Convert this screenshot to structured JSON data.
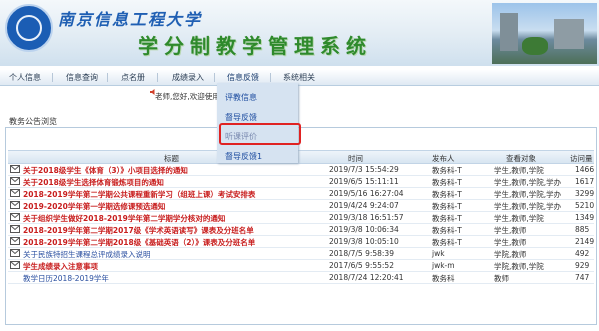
{
  "header": {
    "school_name": "南京信息工程大学",
    "system_name": "学分制教学管理系统"
  },
  "nav": {
    "items": [
      {
        "label": "个人信息"
      },
      {
        "label": "信息查询"
      },
      {
        "label": "点名册"
      },
      {
        "label": "成绩录入"
      },
      {
        "label": "信息反馈"
      },
      {
        "label": "系统相关"
      }
    ]
  },
  "welcome_text": "老师,您好,欢迎使用学分制教学管理系统",
  "dropdown": {
    "items": [
      {
        "label": "评教信息"
      },
      {
        "label": "督导反馈"
      },
      {
        "label": "听课评价"
      },
      {
        "label": "督导反馈1"
      }
    ],
    "highlighted_index": 2
  },
  "notice": {
    "section_title": "教务公告浏览",
    "columns": [
      "标题",
      "时间",
      "发布人",
      "查看对象",
      "访问量"
    ],
    "rows": [
      {
        "title": "关于2018级学生《体育（3）》小项目选择的通知",
        "time": "2019/7/3 15:54:29",
        "publisher": "教务科-T",
        "audience": "学生,教师,学院",
        "views": "1466",
        "style": "red"
      },
      {
        "title": "关于2018级学生选择体育锻炼项目的通知",
        "time": "2019/6/5 15:11:11",
        "publisher": "教务科-T",
        "audience": "学生,教师,学院,学办",
        "views": "1617",
        "style": "red"
      },
      {
        "title": "2018-2019学年第二学期公共课程重新学习（组班上课）考试安排表",
        "time": "2019/5/16 16:27:04",
        "publisher": "教务科-T",
        "audience": "学生,教师,学院,学办",
        "views": "3299",
        "style": "red"
      },
      {
        "title": "2019-2020学年第一学期选修课预选通知",
        "time": "2019/4/24 9:24:07",
        "publisher": "教务科-T",
        "audience": "学生,教师,学院,学办",
        "views": "5210",
        "style": "red"
      },
      {
        "title": "关于组织学生做好2018-2019学年第二学期学分核对的通知",
        "time": "2019/3/18 16:51:57",
        "publisher": "教务科-T",
        "audience": "学生,教师,学院",
        "views": "1349",
        "style": "red"
      },
      {
        "title": "2018-2019学年第二学期2017级《学术英语读写》课表及分班名单",
        "time": "2019/3/8 10:06:34",
        "publisher": "教务科-T",
        "audience": "学生,教师",
        "views": "885",
        "style": "red"
      },
      {
        "title": "2018-2019学年第二学期2018级《基础英语（2）》课表及分班名单",
        "time": "2019/3/8 10:05:10",
        "publisher": "教务科-T",
        "audience": "学生,教师",
        "views": "2149",
        "style": "red"
      },
      {
        "title": "关于民族特招生课程总评成绩录入说明",
        "time": "2018/7/5 9:58:39",
        "publisher": "jwk",
        "audience": "学院,教师",
        "views": "492",
        "style": "blue"
      },
      {
        "title": "学生成绩录入注意事项",
        "time": "2017/6/5 9:55:52",
        "publisher": "jwk-m",
        "audience": "学院,教师,学院",
        "views": "929",
        "style": "red"
      },
      {
        "title": "教学日历2018-2019学年",
        "time": "2018/7/24 12:20:41",
        "publisher": "教务科",
        "audience": "教师",
        "views": "747",
        "style": "blue"
      }
    ]
  },
  "colors": {
    "accent_red": "#c81e1e",
    "link_blue": "#2a4fa0",
    "nav_bg": "#dfe9f3",
    "highlight_box": "#e02222"
  }
}
